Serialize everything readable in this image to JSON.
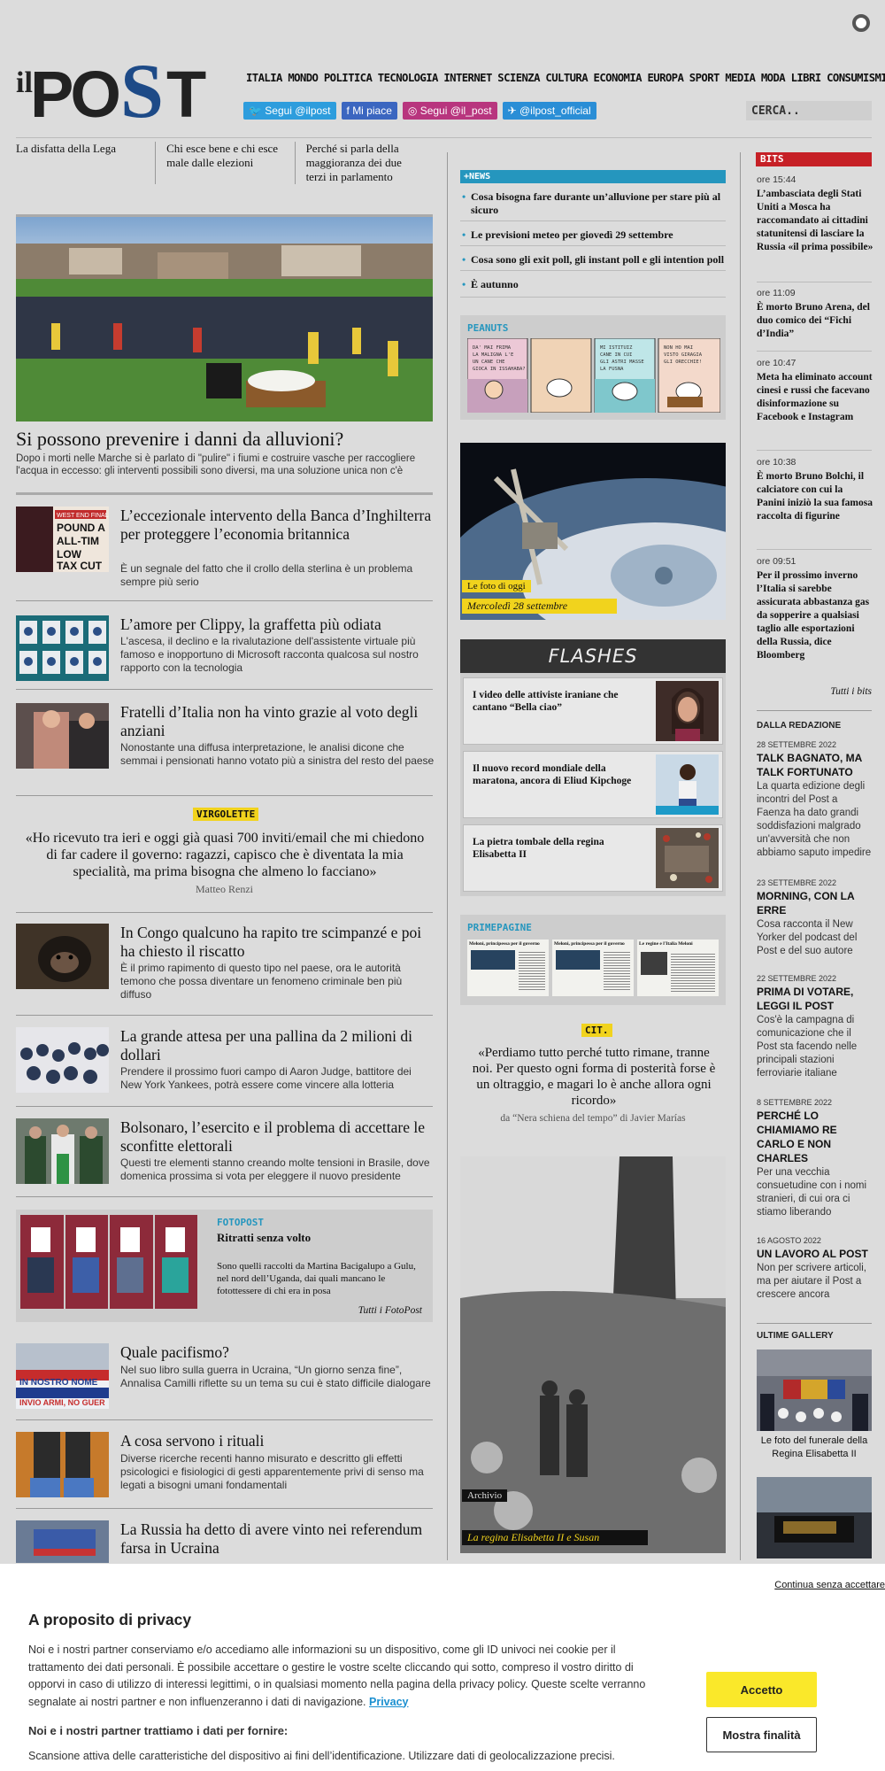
{
  "header": {
    "logo_text": "ilPost",
    "nav": [
      "ITALIA",
      "MONDO",
      "POLITICA",
      "TECNOLOGIA",
      "INTERNET",
      "SCIENZA",
      "CULTURA",
      "ECONOMIA",
      "EUROPA",
      "SPORT",
      "MEDIA",
      "MODA",
      "LIBRI",
      "CONSUMISMI"
    ],
    "social": [
      "Segui @ilpost",
      "Mi piace",
      "Segui @il_post",
      "@ilpost_official"
    ],
    "search_placeholder": "CERCA.."
  },
  "top_links": [
    "La disfatta della Lega",
    "Chi esce bene e chi esce male dalle elezioni",
    "Perché si parla della maggioranza dei due terzi in parlamento"
  ],
  "hero": {
    "title": "Si possono prevenire i danni da alluvioni?",
    "subtitle": "Dopo i morti nelle Marche si è parlato di \"pulire\" i fiumi e costruire vasche per raccogliere l'acqua in eccesso: gli interventi possibili sono diversi, ma una soluzione unica non c'è"
  },
  "stories": [
    {
      "title": "L’eccezionale intervento della Banca d’Inghilterra per proteggere l’economia britannica",
      "subtitle": "È un segnale del fatto che il crollo della sterlina è un problema sempre più serio",
      "thumb_text": "WEST END FINAL POUND A ALL-TIME LOW TAX CUT"
    },
    {
      "title": "L’amore per Clippy, la graffetta più odiata",
      "subtitle": "L'ascesa, il declino e la rivalutazione dell'assistente virtuale più famoso e inopportuno di Microsoft racconta qualcosa sul nostro rapporto con la tecnologia"
    },
    {
      "title": "Fratelli d’Italia non ha vinto grazie al voto degli anziani",
      "subtitle": "Nonostante una diffusa interpretazione, le analisi dicone che semmai i pensionati hanno votato più a sinistra del resto del paese"
    },
    {
      "title": "In Congo qualcuno ha rapito tre scimpanzé e poi ha chiesto il riscatto",
      "subtitle": "È il primo rapimento di questo tipo nel paese, ora le autorità temono che possa diventare un fenomeno criminale ben più diffuso"
    },
    {
      "title": "La grande attesa per una pallina da 2 milioni di dollari",
      "subtitle": "Prendere il prossimo fuori campo di Aaron Judge, battitore dei New York Yankees, potrà essere come vincere alla lotteria"
    },
    {
      "title": "Bolsonaro, l’esercito e il problema di accettare le sconfitte elettorali",
      "subtitle": "Questi tre elementi stanno creando molte tensioni in Brasile, dove domenica prossima si vota per eleggere il nuovo presidente"
    },
    {
      "title": "Quale pacifismo?",
      "subtitle": "Nel suo libro sulla guerra in Ucraina, “Un giorno senza fine”, Annalisa Camilli riflette su un tema su cui è stato difficile dialogare",
      "thumb_text": "IN NOSTRO NOME INVIO ARMI, NO GUER"
    },
    {
      "title": "A cosa servono i rituali",
      "subtitle": "Diverse ricerche recenti hanno misurato e descritto gli effetti psicologici e fisiologici di gesti apparentemente privi di senso ma legati a bisogni umani fondamentali"
    },
    {
      "title": "La Russia ha detto di avere vinto nei referendum farsa in Ucraina",
      "subtitle": ""
    }
  ],
  "virgolette": {
    "label": "VIRGOLETTE",
    "quote": "«Ho ricevuto tra ieri e oggi già quasi 700 inviti/email che mi chiedono di far cadere il governo: ragazzi, capisco che è diventata la mia specialità, ma prima bisogna che almeno lo facciano»",
    "author": "Matteo Renzi"
  },
  "fotopost": {
    "label": "FOTOPOST",
    "title": "Ritratti senza volto",
    "description": "Sono quelli raccolti da Martina Bacigalupo a Gulu, nel nord dell’Uganda, dai quali mancano le fotottessere di chi era in posa",
    "all_link": "Tutti i FotoPost"
  },
  "news": {
    "label": "+NEWS",
    "items": [
      "Cosa bisogna fare durante un’alluvione per stare più al sicuro",
      "Le previsioni meteo per giovedì 29 settembre",
      "Cosa sono gli exit poll, gli instant poll e gli intention poll",
      "È autunno"
    ]
  },
  "peanuts": {
    "label": "PEANUTS",
    "balloons": [
      "DA' MAI FRIMA LA MALIGNA L'E UN CANE CHE GIOCA IN ISSAHABA?",
      "",
      "MI ISTITUIZ CANE IN CUI GLI ASTRI MASSE LA FUSNA",
      "NON HO MAI VISTO GIRAGIA GLI ORECCHIE!"
    ]
  },
  "foto_oggi": {
    "label": "Le foto di oggi",
    "caption": "Mercoledì 28 settembre"
  },
  "flashes": {
    "title": "FLASHES",
    "items": [
      "I video delle attiviste iraniane che cantano “Bella ciao”",
      "Il nuovo record mondiale della maratona, ancora di Eliud Kipchoge",
      "La pietra tombale della regina Elisabetta II"
    ]
  },
  "primepagine": {
    "label": "PRIMEPAGINE",
    "headlines": [
      "Meloni, principessa per il governo",
      "Meloni, principessa per il governo",
      "Le regine e l'Italia Meloni"
    ]
  },
  "cit": {
    "label": "CIT.",
    "quote": "«Perdiamo tutto perché tutto rimane, tranne noi. Per questo ogni forma di posterità forse è un oltraggio, e magari lo è anche allora ogni ricordo»",
    "source": "da “Nera schiena del tempo” di Javier Marías"
  },
  "archivio": {
    "label": "Archivio",
    "caption": "La regina Elisabetta II e Susan"
  },
  "bits": {
    "label": "BITS",
    "items": [
      {
        "time": "ore 15:44",
        "title": "L’ambasciata degli Stati Uniti a Mosca ha raccomandato ai cittadini statunitensi di lasciare la Russia «il prima possibile»"
      },
      {
        "time": "ore 11:09",
        "title": "È morto Bruno Arena, del duo comico dei “Fichi d’India”"
      },
      {
        "time": "ore 10:47",
        "title": "Meta ha eliminato account cinesi e russi che facevano disinformazione su Facebook e Instagram"
      },
      {
        "time": "ore 10:38",
        "title": "È morto Bruno Bolchi, il calciatore con cui la Panini iniziò la sua famosa raccolta di figurine"
      },
      {
        "time": "ore 09:51",
        "title": "Per il prossimo inverno l’Italia si sarebbe assicurata abbastanza gas da sopperire a qualsiasi taglio alle esportazioni della Russia, dice Bloomberg"
      }
    ],
    "all_link": "Tutti i bits"
  },
  "redazione": {
    "label": "DALLA REDAZIONE",
    "items": [
      {
        "date": "28 SETTEMBRE 2022",
        "title": "TALK BAGNATO, MA TALK FORTUNATO",
        "desc": "La quarta edizione degli incontri del Post a Faenza ha dato grandi soddisfazioni malgrado un'avversità che non abbiamo saputo impedire"
      },
      {
        "date": "23 SETTEMBRE 2022",
        "title": "MORNING, CON LA ERRE",
        "desc": "Cosa racconta il New Yorker del podcast del Post e del suo autore"
      },
      {
        "date": "22 SETTEMBRE 2022",
        "title": "PRIMA DI VOTARE, LEGGI IL POST",
        "desc": "Cos'è la campagna di comunicazione che il Post sta facendo nelle principali stazioni ferroviarie italiane"
      },
      {
        "date": "8 SETTEMBRE 2022",
        "title": "PERCHÉ LO CHIAMIAMO RE CARLO E NON CHARLES",
        "desc": "Per una vecchia consuetudine con i nomi stranieri, di cui ora ci stiamo liberando"
      },
      {
        "date": "16 AGOSTO 2022",
        "title": "UN LAVORO AL POST",
        "desc": "Non per scrivere articoli, ma per aiutare il Post a crescere ancora"
      }
    ]
  },
  "gallery": {
    "label": "ULTIME GALLERY",
    "caption": "Le foto del funerale della Regina Elisabetta II"
  },
  "cookie": {
    "skip": "Continua senza accettare",
    "title": "A proposito di privacy",
    "text": "Noi e i nostri partner conserviamo e/o accediamo alle informazioni su un dispositivo, come gli ID univoci nei cookie per il trattamento dei dati personali. È possibile accettare o gestire le vostre scelte cliccando qui sotto, compreso il vostro diritto di opporvi in caso di utilizzo di interessi legittimi, o in qualsiasi momento nella pagina della privacy policy. Queste scelte verranno segnalate ai nostri partner e non influenzeranno i dati di navigazione.",
    "privacy_link": "Privacy",
    "subtitle": "Noi e i nostri partner trattiamo i dati per fornire:",
    "subtext": "Scansione attiva delle caratteristiche del dispositivo ai fini dell’identificazione. Utilizzare dati di geolocalizzazione precisi.",
    "accept": "Accetto",
    "purposes": "Mostra finalità"
  }
}
